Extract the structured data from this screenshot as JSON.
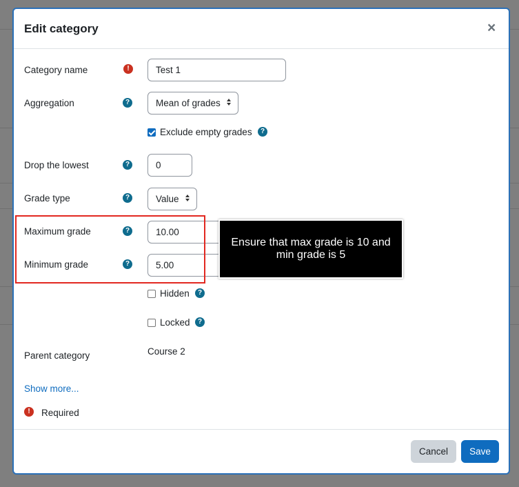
{
  "dialog": {
    "title": "Edit category",
    "close_symbol": "×"
  },
  "form": {
    "category_name": {
      "label": "Category name",
      "value": "Test 1",
      "required": true
    },
    "aggregation": {
      "label": "Aggregation",
      "selected": "Mean of grades"
    },
    "exclude_empty": {
      "label": "Exclude empty grades",
      "checked": true
    },
    "drop_lowest": {
      "label": "Drop the lowest",
      "value": "0"
    },
    "grade_type": {
      "label": "Grade type",
      "selected": "Value"
    },
    "max_grade": {
      "label": "Maximum grade",
      "value": "10.00"
    },
    "min_grade": {
      "label": "Minimum grade",
      "value": "5.00"
    },
    "hidden": {
      "label": "Hidden",
      "checked": false
    },
    "locked": {
      "label": "Locked",
      "checked": false
    },
    "parent_category": {
      "label": "Parent category",
      "value": "Course 2"
    },
    "show_more": "Show more...",
    "required_note": "Required"
  },
  "footer": {
    "cancel_label": "Cancel",
    "save_label": "Save"
  },
  "annotation": {
    "tooltip_text": "Ensure that max grade is 10 and min grade is 5"
  },
  "icons": {
    "help": "question-circle-icon",
    "required": "exclamation-circle-icon"
  },
  "colors": {
    "accent": "#0f6cbf",
    "help_icon": "#0f6c8e",
    "required_icon": "#ca3120",
    "highlight_box": "#e2271f"
  }
}
